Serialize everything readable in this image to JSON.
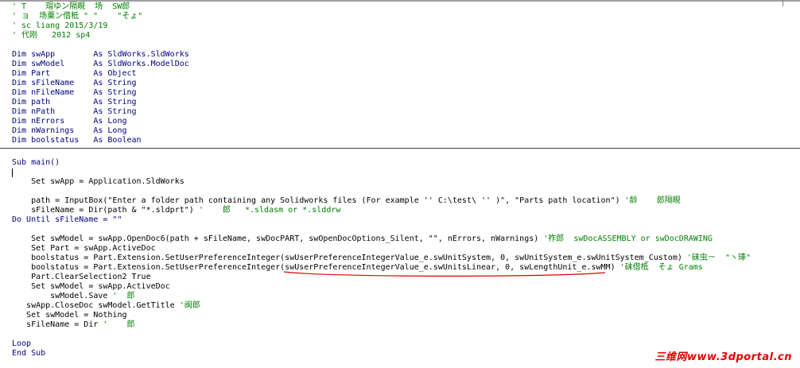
{
  "editor": {
    "declarations": [
      {
        "parts": [
          {
            "t": "' T    瑁ゆン隔睍  场  SW郎",
            "c": "cm"
          }
        ]
      },
      {
        "parts": [
          {
            "t": "' ョ  场粟ン借柢 \" \"    \"そょ\"",
            "c": "cm"
          }
        ]
      },
      {
        "parts": [
          {
            "t": "' sc liang 2015/3/19",
            "c": "cm"
          }
        ]
      },
      {
        "parts": [
          {
            "t": "' 代刚   2012 sp4",
            "c": "cm"
          }
        ]
      },
      {
        "parts": []
      },
      {
        "parts": [
          {
            "t": "Dim swApp        As SldWorks.SldWorks",
            "c": "kw"
          }
        ]
      },
      {
        "parts": [
          {
            "t": "Dim swModel      As SldWorks.ModelDoc",
            "c": "kw"
          }
        ]
      },
      {
        "parts": [
          {
            "t": "Dim Part         As Object",
            "c": "kw"
          }
        ]
      },
      {
        "parts": [
          {
            "t": "Dim sFileName    As String",
            "c": "kw"
          }
        ]
      },
      {
        "parts": [
          {
            "t": "Dim nFileName    As String",
            "c": "kw"
          }
        ]
      },
      {
        "parts": [
          {
            "t": "Dim path         As String",
            "c": "kw"
          }
        ]
      },
      {
        "parts": [
          {
            "t": "Dim nPath        As String",
            "c": "kw"
          }
        ]
      },
      {
        "parts": [
          {
            "t": "Dim nErrors      As Long",
            "c": "kw"
          }
        ]
      },
      {
        "parts": [
          {
            "t": "Dim nWarnings    As Long",
            "c": "kw"
          }
        ]
      },
      {
        "parts": [
          {
            "t": "Dim boolstatus   As Boolean",
            "c": "kw"
          }
        ]
      }
    ],
    "procedure": [
      {
        "parts": [
          {
            "t": "Sub main()",
            "c": "kw"
          }
        ]
      },
      {
        "parts": []
      },
      {
        "parts": [
          {
            "t": "    Set swApp = Application.SldWorks",
            "c": "pl"
          }
        ]
      },
      {
        "parts": []
      },
      {
        "parts": [
          {
            "t": "    path = InputBox(\"Enter a folder path containing any Solidworks files (For example '' C:\\test\\ '' )\", \"Parts path location\") ",
            "c": "pl"
          },
          {
            "t": "'龄    郎隔睍",
            "c": "cm"
          }
        ]
      },
      {
        "parts": [
          {
            "t": "    sFileName = Dir(path & \"*.sldprt\") ",
            "c": "pl"
          },
          {
            "t": "'    郎   *.sldasm or *.slddrw",
            "c": "cm"
          }
        ]
      },
      {
        "parts": [
          {
            "t": "Do Until sFileName = \"\"",
            "c": "kw"
          }
        ]
      },
      {
        "parts": []
      },
      {
        "parts": [
          {
            "t": "    Set swModel = swApp.OpenDoc6(path + sFileName, swDocPART, swOpenDocOptions_Silent, \"\", nErrors, nWarnings) ",
            "c": "pl"
          },
          {
            "t": "'祚郎  swDocASSEMBLY or swDocDRAWING",
            "c": "cm"
          }
        ]
      },
      {
        "parts": [
          {
            "t": "    Set Part = swApp.ActiveDoc",
            "c": "pl"
          }
        ]
      },
      {
        "parts": [
          {
            "t": "    boolstatus = Part.Extension.SetUserPreferenceInteger(swUserPreferenceIntegerValue_e.swUnitSystem, 0, swUnitSystem_e.swUnitSystem_Custom) ",
            "c": "pl"
          },
          {
            "t": "'砞虫ㄧ  \"ヽ琫\"",
            "c": "cm"
          }
        ]
      },
      {
        "parts": [
          {
            "t": "    boolstatus = Part.Extension.SetUserPreferenceInteger(swUserPreferenceIntegerValue_e.swUnitsLinear, 0, swLengthUnit_e.swMM) ",
            "c": "pl"
          },
          {
            "t": "'砞借柢  そょ Grams",
            "c": "cm"
          }
        ]
      },
      {
        "parts": [
          {
            "t": "    Part.ClearSelection2 True",
            "c": "pl"
          }
        ]
      },
      {
        "parts": [
          {
            "t": "    Set swModel = swApp.ActiveDoc",
            "c": "pl"
          }
        ]
      },
      {
        "parts": [
          {
            "t": "        swModel.Save ",
            "c": "pl"
          },
          {
            "t": "'  郎",
            "c": "cm"
          }
        ]
      },
      {
        "parts": [
          {
            "t": "   swApp.CloseDoc swModel.GetTitle ",
            "c": "pl"
          },
          {
            "t": "'闽郎",
            "c": "cm"
          }
        ]
      },
      {
        "parts": [
          {
            "t": "   Set swModel = Nothing",
            "c": "pl"
          }
        ]
      },
      {
        "parts": [
          {
            "t": "   sFileName = Dir ",
            "c": "pl"
          },
          {
            "t": "'    郎",
            "c": "cm"
          }
        ]
      },
      {
        "parts": []
      },
      {
        "parts": [
          {
            "t": "Loop",
            "c": "kw"
          }
        ]
      },
      {
        "parts": [
          {
            "t": "End Sub",
            "c": "kw"
          }
        ]
      }
    ]
  },
  "watermark": "三维网www.3dportal.cn",
  "colors": {
    "keyword": "#00007f",
    "comment": "#007f00",
    "annotation": "#e00000",
    "watermark": "#e60000"
  }
}
